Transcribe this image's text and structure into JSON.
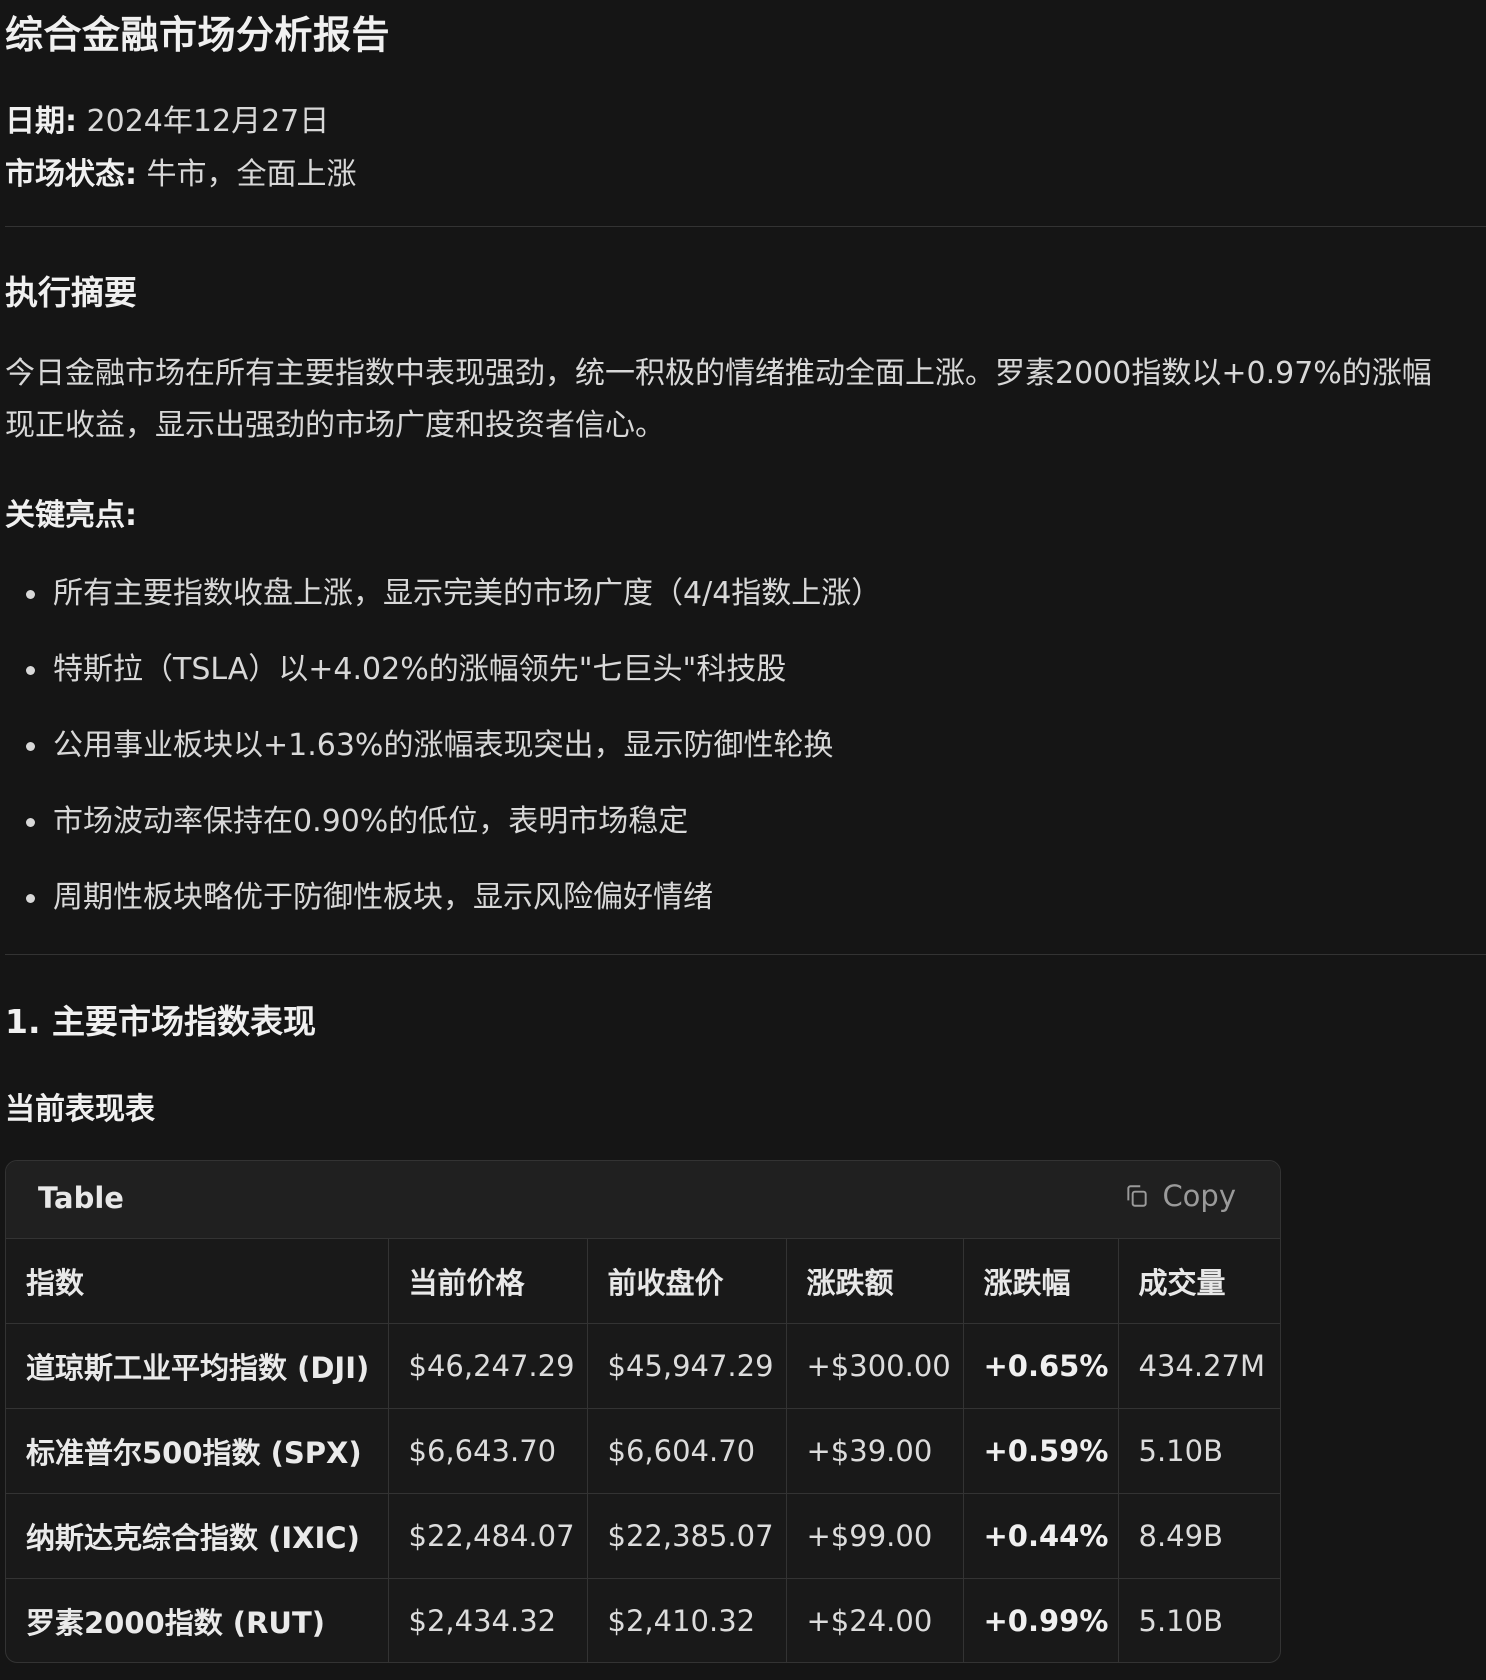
{
  "report": {
    "title": "综合金融市场分析报告",
    "date_label": "日期:",
    "date_value": "2024年12月27日",
    "status_label": "市场状态:",
    "status_value": "牛市，全面上涨"
  },
  "summary": {
    "heading": "执行摘要",
    "line1": "今日金融市场在所有主要指数中表现强劲，统一积极的情绪推动全面上涨。罗素2000指数以+0.97%的涨幅",
    "line2": "现正收益，显示出强劲的市场广度和投资者信心。"
  },
  "highlights": {
    "heading": "关键亮点:",
    "items": [
      "所有主要指数收盘上涨，显示完美的市场广度（4/4指数上涨）",
      "特斯拉（TSLA）以+4.02%的涨幅领先\"七巨头\"科技股",
      "公用事业板块以+1.63%的涨幅表现突出，显示防御性轮换",
      "市场波动率保持在0.90%的低位，表明市场稳定",
      "周期性板块略优于防御性板块，显示风险偏好情绪"
    ]
  },
  "section1": {
    "heading": "1. 主要市场指数表现",
    "subheading": "当前表现表"
  },
  "table": {
    "label": "Table",
    "copy_label": "Copy",
    "copy_icon": "copy-icon",
    "headers": [
      "指数",
      "当前价格",
      "前收盘价",
      "涨跌额",
      "涨跌幅",
      "成交量"
    ],
    "rows": [
      [
        "道琼斯工业平均指数 (DJI)",
        "$46,247.29",
        "$45,947.29",
        "+$300.00",
        "+0.65%",
        "434.27M"
      ],
      [
        "标准普尔500指数 (SPX)",
        "$6,643.70",
        "$6,604.70",
        "+$39.00",
        "+0.59%",
        "5.10B"
      ],
      [
        "纳斯达克综合指数 (IXIC)",
        "$22,484.07",
        "$22,385.07",
        "+$99.00",
        "+0.44%",
        "8.49B"
      ],
      [
        "罗素2000指数 (RUT)",
        "$2,434.32",
        "$2,410.32",
        "+$24.00",
        "+0.99%",
        "5.10B"
      ]
    ]
  }
}
